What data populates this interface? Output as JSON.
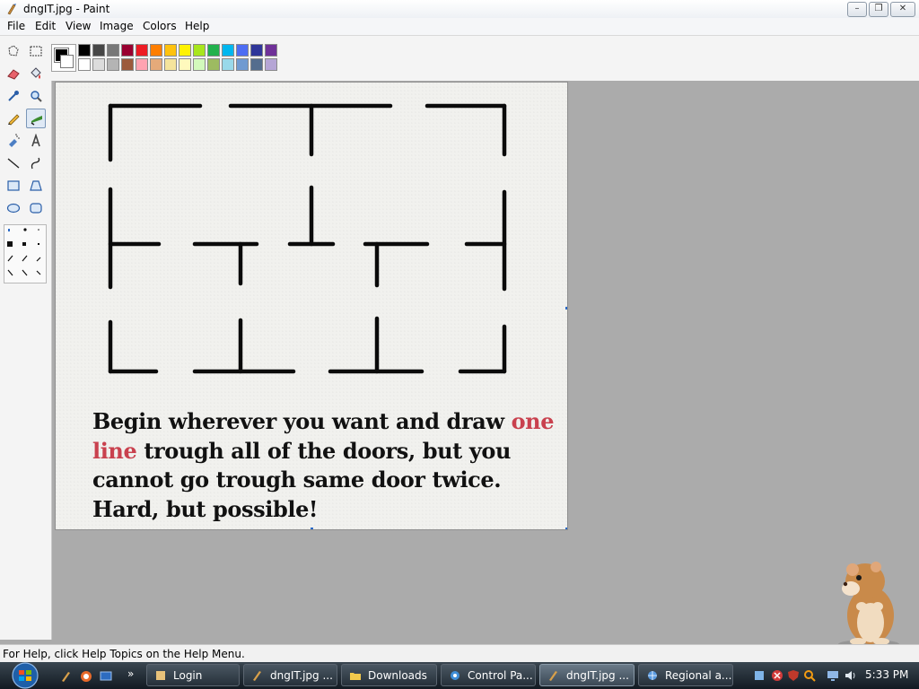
{
  "window": {
    "title": "dngIT.jpg - Paint",
    "buttons": [
      "minimize",
      "maximize",
      "close"
    ]
  },
  "menu": [
    "File",
    "Edit",
    "View",
    "Image",
    "Colors",
    "Help"
  ],
  "tools": [
    {
      "name": "free-form-select-icon"
    },
    {
      "name": "select-icon"
    },
    {
      "name": "eraser-icon"
    },
    {
      "name": "fill-bucket-icon"
    },
    {
      "name": "pick-color-icon"
    },
    {
      "name": "magnifier-icon"
    },
    {
      "name": "pencil-icon"
    },
    {
      "name": "brush-icon"
    },
    {
      "name": "airbrush-icon"
    },
    {
      "name": "text-icon"
    },
    {
      "name": "line-icon"
    },
    {
      "name": "curve-icon"
    },
    {
      "name": "rectangle-icon"
    },
    {
      "name": "polygon-icon"
    },
    {
      "name": "ellipse-icon"
    },
    {
      "name": "rounded-rectangle-icon"
    }
  ],
  "palette": {
    "foreground": "#000000",
    "background": "#ffffff",
    "row1": [
      "#000000",
      "#464646",
      "#787878",
      "#990030",
      "#ed1c24",
      "#ff7e00",
      "#ffc20e",
      "#fff200",
      "#a8e61d",
      "#22b14c",
      "#00b7ef",
      "#4d6df3",
      "#2f3699",
      "#6f3198"
    ],
    "row2": [
      "#ffffff",
      "#dcdcdc",
      "#b4b4b4",
      "#9c5a3c",
      "#ffa3b1",
      "#e5aa7a",
      "#f5e49c",
      "#fff9bd",
      "#d3f9bc",
      "#9dbb61",
      "#99d9ea",
      "#709ad1",
      "#546d8e",
      "#b5a5d5"
    ]
  },
  "canvas_text": {
    "line1a": "Begin wherever you want and draw ",
    "line1b": "one",
    "line2a": "line",
    "line2b": " trough all of the doors, but you",
    "line3": "cannot go trough same door twice.",
    "line4": "Hard, but possible!"
  },
  "status": "For Help, click Help Topics on the Help Menu.",
  "taskbar": {
    "items": [
      {
        "label": "Login"
      },
      {
        "label": "dngIT.jpg ..."
      },
      {
        "label": "Downloads"
      },
      {
        "label": "Control Pa..."
      },
      {
        "label": "dngIT.jpg ..."
      },
      {
        "label": "Regional a..."
      }
    ],
    "clock": "5:33 PM"
  }
}
